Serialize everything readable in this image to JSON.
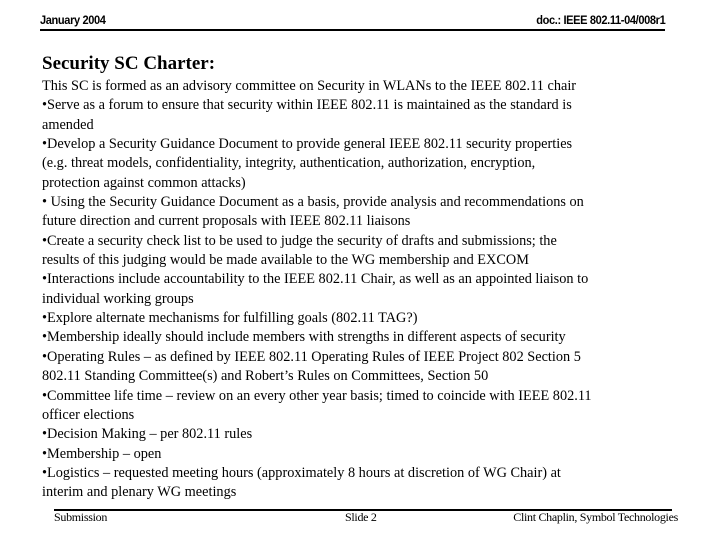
{
  "header": {
    "date": "January 2004",
    "doc_id": "doc.: IEEE 802.11-04/008r1"
  },
  "slide": {
    "title": "Security SC Charter:",
    "lines": [
      "This SC is formed as an advisory committee on Security in WLANs to the IEEE 802.11 chair",
      "•Serve as a forum to ensure that security within IEEE 802.11 is maintained as the standard is",
      "amended",
      "•Develop a Security Guidance Document to provide general IEEE 802.11 security properties",
      "(e.g. threat models, confidentiality, integrity, authentication, authorization, encryption,",
      "protection against common attacks)",
      "• Using the Security Guidance Document as a basis, provide analysis and recommendations on",
      "future direction and current proposals with IEEE 802.11 liaisons",
      "•Create a security check list to be used to judge the security of drafts and submissions; the",
      "results of this judging would be made available to the WG membership and EXCOM",
      "•Interactions include accountability to the IEEE 802.11 Chair, as well as an appointed liaison to",
      "individual working groups",
      "•Explore alternate mechanisms for fulfilling goals (802.11 TAG?)",
      "•Membership ideally should include members with strengths in different aspects of security",
      "•Operating Rules – as defined by  IEEE 802.11 Operating Rules of IEEE Project 802 Section 5",
      "802.11 Standing Committee(s) and Robert’s Rules on Committees, Section 50",
      "•Committee life time – review on an every other year basis; timed to coincide with IEEE 802.11",
      "officer elections",
      "•Decision Making – per 802.11 rules",
      "•Membership – open",
      "•Logistics – requested meeting hours (approximately 8 hours at discretion of WG Chair) at",
      "interim and plenary WG meetings"
    ]
  },
  "footer": {
    "left": "Submission",
    "center": "Slide 2",
    "right": "Clint Chaplin, Symbol Technologies"
  }
}
